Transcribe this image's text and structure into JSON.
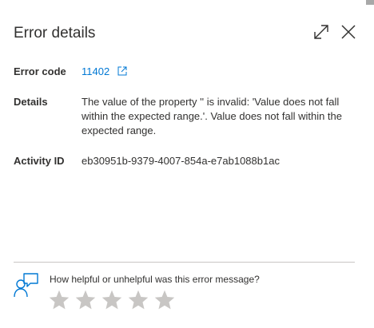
{
  "header": {
    "title": "Error details",
    "expand_icon": "expand-icon",
    "close_icon": "close-icon"
  },
  "fields": {
    "error_code": {
      "label": "Error code",
      "value": "11402",
      "icon": "external-link-icon"
    },
    "details": {
      "label": "Details",
      "value": "The value of the property '' is invalid: 'Value does not fall within the expected range.'. Value does not fall within the expected range."
    },
    "activity_id": {
      "label": "Activity ID",
      "value": "eb30951b-9379-4007-854a-e7ab1088b1ac"
    }
  },
  "feedback": {
    "question": "How helpful or unhelpful was this error message?",
    "icon": "feedback-person-icon",
    "rating_max": 5,
    "rating": 0
  },
  "colors": {
    "link": "#0078d4",
    "text": "#323130",
    "star": "#c8c6c4",
    "feedback_icon": "#0078d4"
  }
}
